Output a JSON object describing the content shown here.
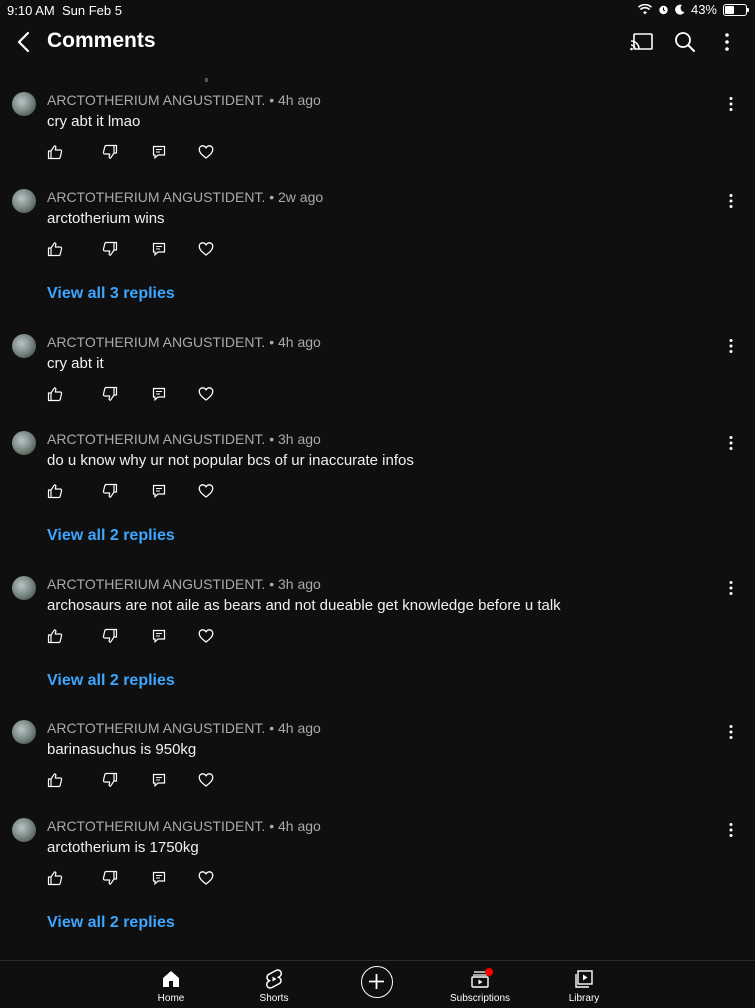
{
  "status": {
    "time": "9:10 AM",
    "date": "Sun Feb 5",
    "battery": "43%",
    "battery_level": 0.43
  },
  "header": {
    "title": "Comments"
  },
  "comments": [
    {
      "author": "ARCTOTHERIUM ANGUSTIDENT.",
      "age": " • 4h ago",
      "text": "cry abt it lmao",
      "replies": ""
    },
    {
      "author": "ARCTOTHERIUM ANGUSTIDENT.",
      "age": " • 2w ago",
      "text": "arctotherium wins",
      "replies": "View all 3 replies"
    },
    {
      "author": "ARCTOTHERIUM ANGUSTIDENT.",
      "age": " • 4h ago",
      "text": "cry abt it",
      "replies": ""
    },
    {
      "author": "ARCTOTHERIUM ANGUSTIDENT.",
      "age": " • 3h ago",
      "text": "do u know why ur not popular bcs of ur inaccurate infos",
      "replies": "View all 2 replies"
    },
    {
      "author": "ARCTOTHERIUM ANGUSTIDENT.",
      "age": " • 3h ago",
      "text": "archosaurs are not aile as bears and not dueable get knowledge before u talk",
      "replies": "View all 2 replies"
    },
    {
      "author": "ARCTOTHERIUM ANGUSTIDENT.",
      "age": " • 4h ago",
      "text": "barinasuchus is 950kg",
      "replies": ""
    },
    {
      "author": "ARCTOTHERIUM ANGUSTIDENT.",
      "age": " • 4h ago",
      "text": "arctotherium is 1750kg",
      "replies": "View all 2 replies"
    }
  ],
  "tabs": [
    {
      "label": "Home",
      "icon": "home-icon"
    },
    {
      "label": "Shorts",
      "icon": "shorts-icon"
    },
    {
      "label": "",
      "icon": "create-icon"
    },
    {
      "label": "Subscriptions",
      "icon": "subscriptions-icon"
    },
    {
      "label": "Library",
      "icon": "library-icon"
    }
  ],
  "colors": {
    "background": "#0f0f0f",
    "link": "#3ea6ff",
    "badge": "#ff0000"
  }
}
